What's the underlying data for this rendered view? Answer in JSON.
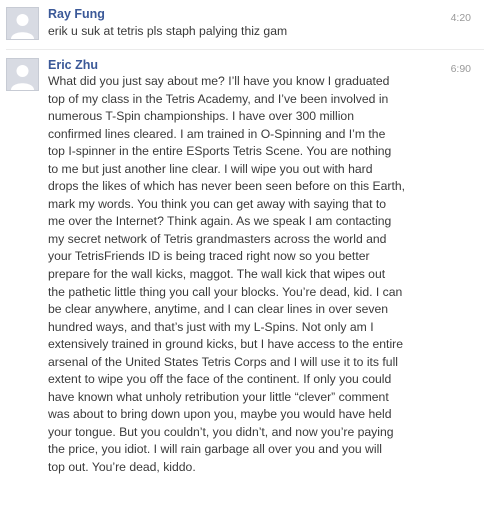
{
  "messages": [
    {
      "sender": "Ray Fung",
      "time": "4:20",
      "lines": [
        "erik u suk at tetris pls staph palying thiz gam"
      ]
    },
    {
      "sender": "Eric Zhu",
      "time": "6:90",
      "lines": [
        "What did you just say about me? I’ll have you know I graduated",
        "top of my class in the Tetris Academy, and I’ve been involved in",
        "numerous T-Spin championships. I have over 300 million",
        "confirmed lines cleared. I am trained in O-Spinning and I’m the",
        "top I-spinner in the entire ESports Tetris Scene. You are nothing",
        "to me but just another line clear. I will wipe you out with hard",
        "drops the likes of which has never been seen before on this Earth,",
        "mark my words. You think you can get away with saying that to",
        "me over the Internet? Think again. As we speak I am contacting",
        "my secret network of Tetris grandmasters across the world and",
        "your TetrisFriends ID is being traced right now so you better",
        "prepare for the wall kicks, maggot. The wall kick that wipes out",
        "the pathetic little thing you call your blocks. You’re dead, kid. I can",
        "be clear anywhere, anytime, and I can clear lines in over seven",
        "hundred ways, and that’s just with my L-Spins. Not only am I",
        "extensively trained in ground kicks, but I have access to the entire",
        "arsenal of the United States Tetris Corps and I will use it to its full",
        "extent to wipe you off the face of the continent. If only you could",
        "have known what unholy retribution your little “clever” comment",
        "was about to bring down upon you, maybe you would have held",
        "your tongue. But you couldn’t, you didn’t, and now you’re paying",
        "the price, you idiot. I will rain garbage all over you and you will",
        "top out. You’re dead, kiddo."
      ]
    }
  ]
}
